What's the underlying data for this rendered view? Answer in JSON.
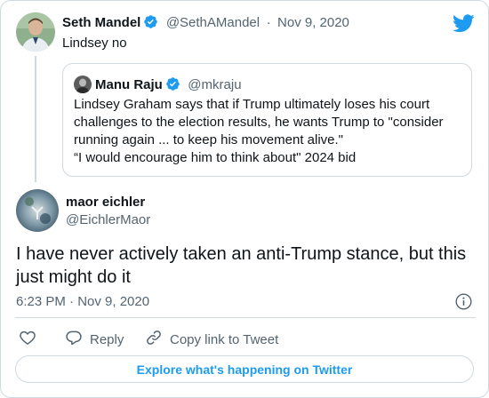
{
  "parent_tweet": {
    "display_name": "Seth Mandel",
    "handle": "@SethAMandel",
    "separator": "·",
    "date": "Nov 9, 2020",
    "text": "Lindsey no"
  },
  "quoted_tweet": {
    "display_name": "Manu Raju",
    "handle": "@mkraju",
    "lines": [
      "Lindsey Graham says that if Trump ultimately loses his court",
      "challenges to the election results, he wants Trump to \"consider",
      "running again ... to keep his movement alive.\"",
      "“I would encourage him to think about\" 2024 bid"
    ]
  },
  "main_tweet": {
    "display_name": "maor eichler",
    "handle": "@EichlerMaor",
    "text_lines": [
      "I have never actively taken an anti-Trump stance, but this",
      "just might do it"
    ],
    "timestamp": "6:23 PM · Nov 9, 2020"
  },
  "actions": {
    "reply_label": "Reply",
    "copy_link_label": "Copy link to Tweet"
  },
  "footer": {
    "explore_label": "Explore what's happening on Twitter"
  },
  "colors": {
    "accent": "#1d9bf0",
    "text": "#0f1419",
    "muted": "#536471",
    "border": "#cfd9de"
  },
  "icons": [
    "twitter-bird-icon",
    "verified-badge-icon",
    "info-icon",
    "heart-icon",
    "reply-icon",
    "link-icon"
  ]
}
